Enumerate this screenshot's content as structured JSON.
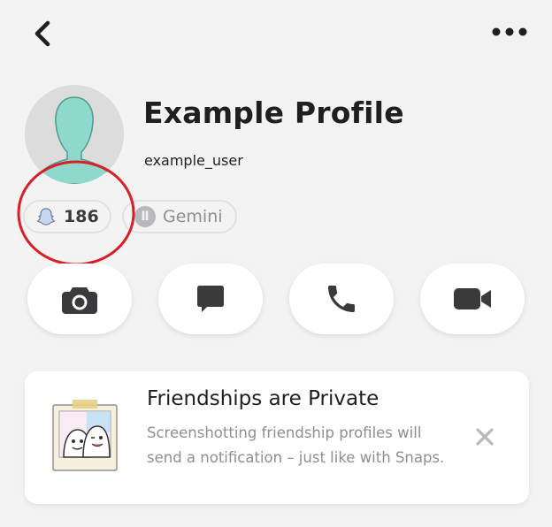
{
  "header": {
    "back_icon": "chevron-left-icon",
    "more_icon": "ellipsis-icon"
  },
  "profile": {
    "display_name": "Example Profile",
    "username": "example_user",
    "avatar_icon": "bitmoji-silhouette-icon",
    "avatar_color": "#8fd8cc"
  },
  "badges": {
    "snap_score": "186",
    "snap_score_icon": "ghost-icon",
    "zodiac_symbol": "Ⅱ",
    "zodiac_label": "Gemini"
  },
  "highlight": {
    "color": "#d81f26",
    "target": "snap-score"
  },
  "actions": [
    {
      "icon": "camera-icon"
    },
    {
      "icon": "chat-icon"
    },
    {
      "icon": "phone-icon"
    },
    {
      "icon": "video-camera-icon"
    }
  ],
  "notice": {
    "title": "Friendships are Private",
    "body": "Screenshotting friendship profiles will send a notification – just like with Snaps.",
    "illustration": "friends-polaroid-illustration",
    "close_icon": "close-icon"
  }
}
